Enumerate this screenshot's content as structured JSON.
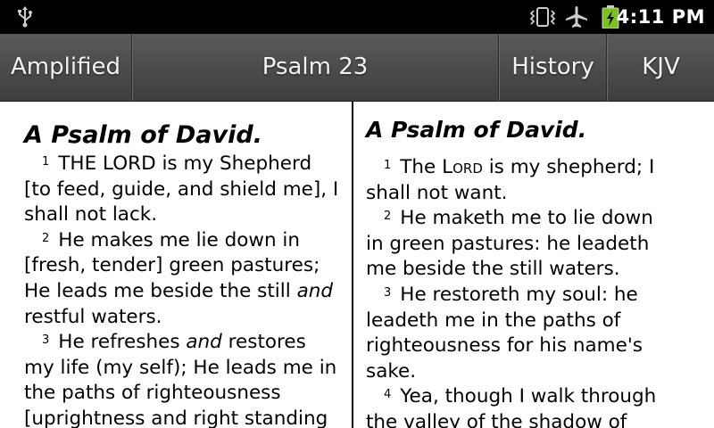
{
  "status_bar": {
    "time": "4:11 PM",
    "icons": [
      "usb-icon",
      "vibrate-icon",
      "airplane-icon",
      "battery-charging-icon"
    ]
  },
  "action_bar": {
    "left_translation": "Amplified",
    "title": "Psalm 23",
    "history": "History",
    "right_translation": "KJV"
  },
  "left_pane": {
    "heading": "A Psalm of David.",
    "verses": [
      {
        "num": "1",
        "text": "THE LORD is my Shepherd [to feed, guide, and shield me], I shall not lack."
      },
      {
        "num": "2",
        "pre": "He makes me lie down in [fresh, tender] green pastures; He leads me beside the still ",
        "italic": "and",
        "post": " restful waters."
      },
      {
        "num": "3",
        "pre": "He refreshes ",
        "italic": "and",
        "post": " restores my life (my self); He leads me in the paths of righteousness [uprightness and right standing"
      }
    ]
  },
  "right_pane": {
    "heading": "A Psalm of David.",
    "verses": [
      {
        "num": "1",
        "pre": "The ",
        "smallcaps": "Lord",
        "post": " is my shepherd; I shall not want."
      },
      {
        "num": "2",
        "text": "He maketh me to lie down in green pastures: he leadeth me beside the still waters."
      },
      {
        "num": "3",
        "text": "He restoreth my soul: he leadeth me in the paths of righteousness for his name's sake."
      },
      {
        "num": "4",
        "text": "Yea, though I walk through the valley of the shadow of"
      }
    ]
  },
  "colors": {
    "status_bar_bg": "#000000",
    "action_bar_top": "#5a5a5a",
    "action_bar_bottom": "#3e3e3e",
    "battery_green": "#7cc022"
  }
}
